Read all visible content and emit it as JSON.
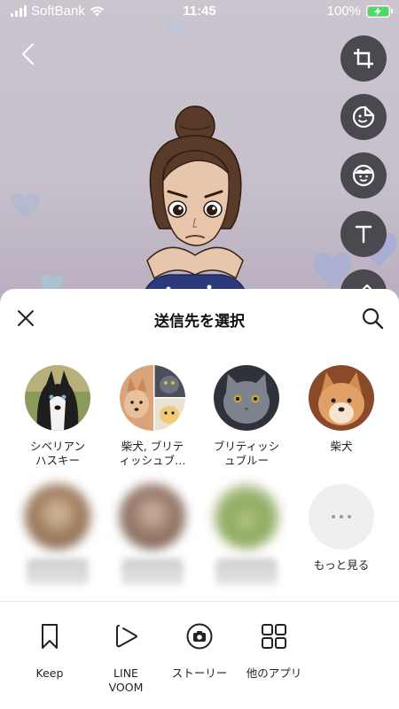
{
  "status_bar": {
    "carrier": "SoftBank",
    "time": "11:45",
    "battery": "100%"
  },
  "editor": {
    "tools": [
      {
        "name": "crop-icon"
      },
      {
        "name": "sticker-icon"
      },
      {
        "name": "avatar-face-icon"
      },
      {
        "name": "text-icon"
      },
      {
        "name": "pen-icon"
      }
    ]
  },
  "sheet": {
    "title": "送信先を選択",
    "friends": [
      {
        "name": "シベリアン\nハスキー",
        "blurred": false
      },
      {
        "name": "柴犬, ブリテ\nィッシュブ…",
        "blurred": false
      },
      {
        "name": "ブリティッシ\nュブルー",
        "blurred": false
      },
      {
        "name": "柴犬",
        "blurred": false
      }
    ],
    "more_label": "もっと見る",
    "share_options": [
      {
        "label": "Keep",
        "icon": "bookmark-icon"
      },
      {
        "label": "LINE\nVOOM",
        "icon": "voom-play-icon"
      },
      {
        "label": "ストーリー",
        "icon": "camera-story-icon"
      },
      {
        "label": "他のアプリ",
        "icon": "grid-apps-icon"
      }
    ]
  },
  "colors": {
    "accent_green": "#4cd964",
    "tool_bg": "#4b4950"
  }
}
